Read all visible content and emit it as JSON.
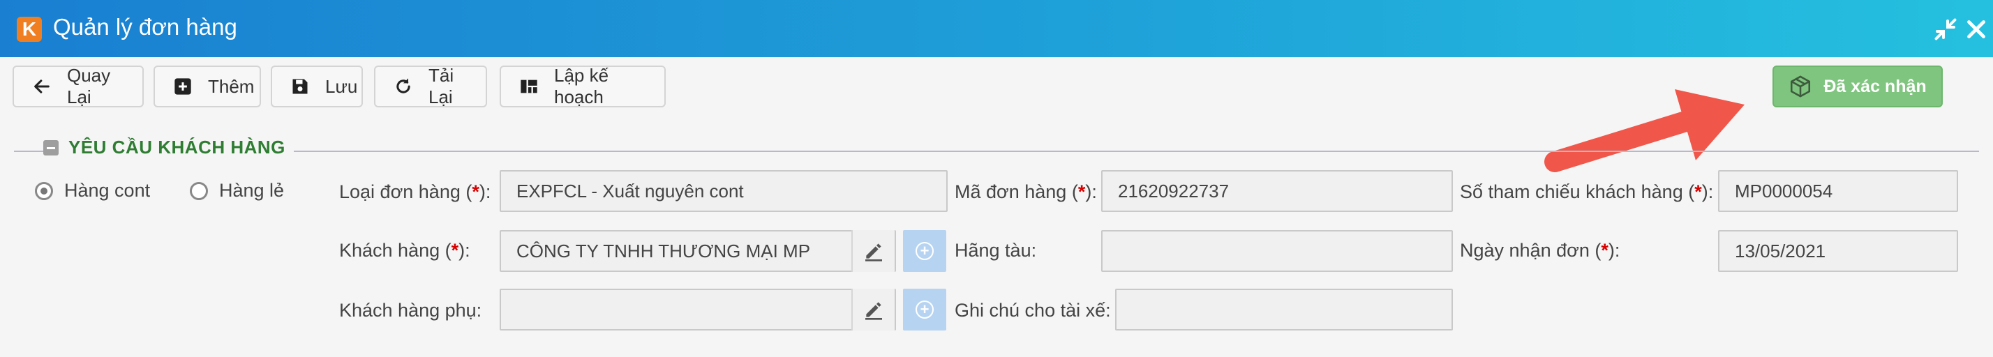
{
  "window": {
    "logo_letter": "K",
    "title": "Quản lý đơn hàng"
  },
  "toolbar": {
    "back_label": "Quay Lại",
    "add_label": "Thêm",
    "save_label": "Lưu",
    "reload_label": "Tải Lại",
    "plan_label": "Lập kế hoạch",
    "confirmed_label": "Đã xác nhận"
  },
  "colors": {
    "titlebar_start": "#1a7fd1",
    "titlebar_end": "#25c0df",
    "confirm_green": "#7fc57f",
    "section_green": "#2e7d32",
    "arrow_red": "#f0574a",
    "required_red": "#d50000"
  },
  "section": {
    "title": "YÊU CẦU KHÁCH HÀNG"
  },
  "radios": {
    "cont_label": "Hàng cont",
    "le_label": "Hàng lẻ",
    "selected": "Hàng cont"
  },
  "form": {
    "order_type_label": "Loại đơn hàng (",
    "order_type_value": "EXPFCL - Xuất nguyên cont",
    "order_code_label": "Mã đơn hàng (",
    "order_code_value": "21620922737",
    "customer_ref_label": "Số tham chiếu khách hàng (",
    "customer_ref_value": "MP0000054",
    "customer_label": "Khách hàng (",
    "customer_value": "CÔNG TY TNHH THƯƠNG MẠI MP",
    "shipping_line_label": "Hãng tàu:",
    "shipping_line_value": "",
    "received_date_label": "Ngày nhận đơn (",
    "received_date_value": "13/05/2021",
    "sub_customer_label": "Khách hàng phụ:",
    "sub_customer_value": "",
    "driver_note_label": "Ghi chú cho tài xế:",
    "driver_note_value": "",
    "req_mark": "*",
    "req_close": "):"
  },
  "icons": {
    "minimize": "compress-icon",
    "close": "close-icon",
    "back": "arrow-left-icon",
    "add": "plus-square-icon",
    "save": "floppy-disk-icon",
    "reload": "refresh-icon",
    "plan": "layout-grid-icon",
    "confirmed": "package-box-icon",
    "edit": "pencil-icon",
    "add_circle": "plus-circle-icon"
  }
}
